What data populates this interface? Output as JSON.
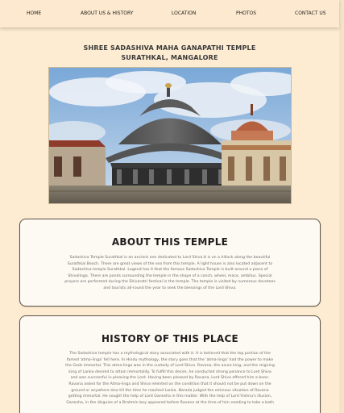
{
  "nav": {
    "items": [
      {
        "label": "HOME"
      },
      {
        "label": "ABOUT US & HISTORY"
      },
      {
        "label": "LOCATION"
      },
      {
        "label": "PHOTOS"
      },
      {
        "label": "CONTACT US"
      }
    ]
  },
  "header": {
    "title_line1": "SHREE SADASHIVA MAHA GANAPATHI TEMPLE",
    "title_line2": "SURATHKAL, MANGALORE"
  },
  "about": {
    "heading": "ABOUT THIS TEMPLE",
    "lines": [
      "Sadashiva Temple Surathkal is an ancient one dedicated to Lord Shiva.It is on a hillock along the beautiful",
      "Surathkal Beach. There are great views of the sea from this temple. A light house is also located adjacent to",
      "Sadashiva temple Surathkal. Legend has it that the famous Sadashiva Temple is built around a piece of",
      "Shivalinga. There are ponds surrounding the temple in the shape of a conch, wheel, mace, ambitus. Special",
      "prayers are performed during the Shivaratri festival in the temple. The temple is visited by numerous devotees",
      "and tourists all-round the year to seek the blessings of the Lord Shiva."
    ]
  },
  "history": {
    "heading": "HISTORY OF THIS PLACE",
    "lines": [
      "The Sadashiva temple has a mythological story associated with it. It is believed that the top portion of the",
      "famed 'atma-linga' fell here. In Hindu mythology, the story goes that the 'atma-linga' had the power to make",
      "the Gods immortal. This atma-linga was in the custody of Lord Shiva. Ravana, the asura king, and the reigning",
      "king of Lanka desired to attain immortality. To fulfill this desire, he conducted strong penance to Lord Shiva",
      "and was successful in pleasing the Lord. Having been pleased by Ravana, Lord Shiva offered him a boon.",
      "Ravana asked for the Atma-linga and Shiva relented on the condition that it should not be put down on the",
      "ground or anywhere else till the time he reached Lanka. Narada judged the ominous situation of Ravana",
      "getting immortal. He sought the help of Lord Ganesha in this matter. With the help of Lord Vishnu's illusion,",
      "Ganesha, in the disguise of a Brahmin boy appeared before Ravana at the time of him needing to take a bath"
    ]
  },
  "colors": {
    "page_bg": "#fdecd2",
    "card_bg": "#fdf9f3",
    "card_border": "#5b5348"
  }
}
